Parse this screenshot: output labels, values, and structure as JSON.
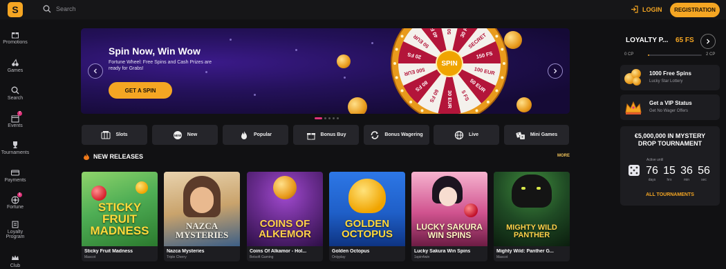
{
  "header": {
    "logo_letter": "S",
    "search_placeholder": "Search",
    "login_label": "LOGIN",
    "registration_label": "REGISTRATION",
    "accent": "#f5a623"
  },
  "sidebar": {
    "items": [
      {
        "label": "Promotions",
        "icon": "gift-icon"
      },
      {
        "label": "Games",
        "icon": "cherries-icon"
      },
      {
        "label": "Search",
        "icon": "search-icon"
      },
      {
        "label": "Events",
        "icon": "calendar-icon",
        "badge": "7"
      },
      {
        "label": "Tournaments",
        "icon": "trophy-icon"
      },
      {
        "label": "Payments",
        "icon": "card-icon"
      },
      {
        "label": "Fortune",
        "icon": "fortune-icon",
        "badge": "1"
      },
      {
        "label": "Loyalty\nProgram",
        "icon": "loyalty-icon"
      },
      {
        "label": "Club",
        "icon": "crown-icon"
      }
    ]
  },
  "banner": {
    "title": "Spin Now, Win Wow",
    "subtitle": "Fortune Wheel: Free Spins and Cash Prizes are ready for Grabs!",
    "cta": "GET A SPIN",
    "wheel_center": "SPIN",
    "wheel_segments": [
      "50 FS",
      "30 FS",
      "SECRET",
      "150 FS",
      "100 EUR",
      "50 EUR",
      "5 FS",
      "30 EUR",
      "60 FS",
      "80 FS",
      "500 EUR",
      "20 FS",
      "50 EUR",
      "40 FS"
    ],
    "slide_count": 5,
    "active_slide": 1
  },
  "categories": [
    {
      "label": "Slots",
      "icon": "slot-icon"
    },
    {
      "label": "New",
      "icon": "new-icon"
    },
    {
      "label": "Popular",
      "icon": "flame-icon"
    },
    {
      "label": "Bonus Buy",
      "icon": "gift-box-icon"
    },
    {
      "label": "Bonus Wagering",
      "icon": "refresh-icon"
    },
    {
      "label": "Live",
      "icon": "globe-icon"
    },
    {
      "label": "Mini Games",
      "icon": "dice-icon"
    }
  ],
  "new_releases": {
    "title": "NEW RELEASES",
    "more_label": "MORE",
    "games": [
      {
        "name": "Sticky Fruit Madness",
        "provider": "Mascot",
        "art_text": "STICKY FRUIT MADNESS",
        "bg": "#4fae55"
      },
      {
        "name": "Nazca Mysteries",
        "provider": "Triple Cherry",
        "art_text": "NAZCA MYSTERIES",
        "bg": "#c9a36c"
      },
      {
        "name": "Coins Of Alkamor - Hol...",
        "provider": "Betsoft Gaming",
        "art_text": "COINS OF ALKEMOR",
        "bg": "#6a2c8f"
      },
      {
        "name": "Golden Octopus",
        "provider": "Onlyplay",
        "art_text": "GOLDEN OCTOPUS",
        "bg": "#1f5fc8"
      },
      {
        "name": "Lucky Sakura Win Spins",
        "provider": "1spin4win",
        "art_text": "LUCKY SAKURA WIN SPINS",
        "bg": "#d0538f"
      },
      {
        "name": "Mighty Wild: Panther G...",
        "provider": "Mascot",
        "art_text": "MIGHTY WILD PANTHER",
        "bg": "#1f4a24"
      }
    ]
  },
  "loyalty": {
    "title": "LOYALTY P...",
    "free_spins": "65 FS",
    "cp_from": "0 CP",
    "cp_to": "2 CP",
    "progress": 0.02
  },
  "promos": [
    {
      "title": "1000 Free Spins",
      "subtitle": "Lucky Star Lottery",
      "icon": "coins-icon"
    },
    {
      "title": "Get a VIP Status",
      "subtitle": "Get No Wager Offers",
      "icon": "crown-icon"
    }
  ],
  "tournament": {
    "title": "€5,000,000 IN MYSTERY DROP TOURNAMENT",
    "active_label": "Active until",
    "days": "76",
    "days_label": "days",
    "hrs": "15",
    "hrs_label": "hrs",
    "min": "36",
    "min_label": "min",
    "sec": "56",
    "sec_label": "sec",
    "link": "ALL TOURNAMENTS"
  }
}
